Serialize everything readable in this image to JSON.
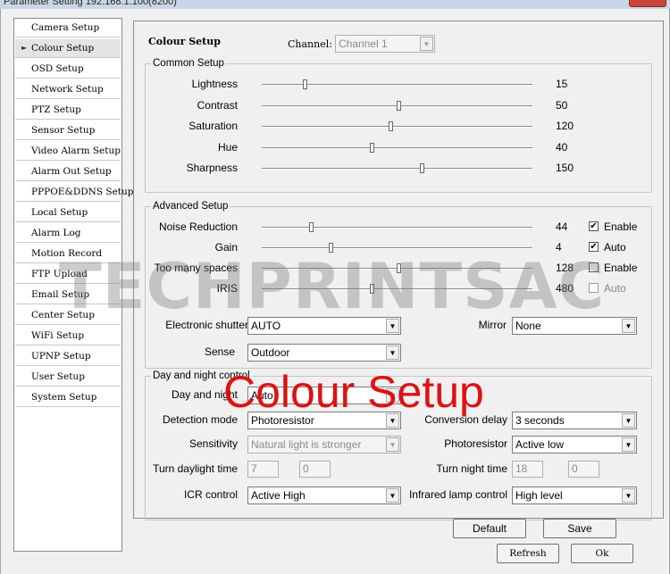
{
  "window_title": "Parameter Setting 192.168.1.100(8200)",
  "sidebar": {
    "items": [
      {
        "label": "Camera Setup",
        "active": false
      },
      {
        "label": "Colour Setup",
        "active": true
      },
      {
        "label": "OSD Setup",
        "active": false
      },
      {
        "label": "Network Setup",
        "active": false
      },
      {
        "label": "PTZ Setup",
        "active": false
      },
      {
        "label": "Sensor Setup",
        "active": false
      },
      {
        "label": "Video Alarm Setup",
        "active": false
      },
      {
        "label": "Alarm Out Setup",
        "active": false
      },
      {
        "label": "PPPOE&DDNS Setup",
        "active": false
      },
      {
        "label": "Local Setup",
        "active": false
      },
      {
        "label": "Alarm Log",
        "active": false
      },
      {
        "label": "Motion Record",
        "active": false
      },
      {
        "label": "FTP Upload",
        "active": false
      },
      {
        "label": "Email Setup",
        "active": false
      },
      {
        "label": "Center Setup",
        "active": false
      },
      {
        "label": "WiFi Setup",
        "active": false
      },
      {
        "label": "UPNP Setup",
        "active": false
      },
      {
        "label": "User Setup",
        "active": false
      },
      {
        "label": "System Setup",
        "active": false
      }
    ]
  },
  "header": {
    "title": "Colour Setup",
    "channel_label": "Channel:",
    "channel_value": "Channel 1"
  },
  "common": {
    "title": "Common Setup",
    "sliders": [
      {
        "label": "Lightness",
        "value": 15,
        "fraction": 0.16
      },
      {
        "label": "Contrast",
        "value": 50,
        "fraction": 0.505
      },
      {
        "label": "Saturation",
        "value": 120,
        "fraction": 0.475
      },
      {
        "label": "Hue",
        "value": 40,
        "fraction": 0.405
      },
      {
        "label": "Sharpness",
        "value": 150,
        "fraction": 0.59
      }
    ]
  },
  "advanced": {
    "title": "Advanced Setup",
    "sliders": [
      {
        "label": "Noise Reduction",
        "value": 44,
        "fraction": 0.18,
        "check_label": "Enable",
        "checked": true,
        "check_disabled": false
      },
      {
        "label": "Gain",
        "value": 4,
        "fraction": 0.255,
        "check_label": "Auto",
        "checked": true,
        "check_disabled": false
      },
      {
        "label": "Too many spaces",
        "value": 128,
        "fraction": 0.505,
        "check_label": "Enable",
        "checked": false,
        "check_disabled": false
      },
      {
        "label": "IRIS",
        "value": 480,
        "fraction": 0.405,
        "check_label": "Auto",
        "checked": false,
        "check_disabled": true
      }
    ],
    "electronic_shutter_label": "Electronic shutter",
    "electronic_shutter_value": "AUTO",
    "mirror_label": "Mirror",
    "mirror_value": "None",
    "sense_label": "Sense",
    "sense_value": "Outdoor"
  },
  "daynight": {
    "title": "Day and night control",
    "day_night_label": "Day and night",
    "day_night_value": "Auto",
    "detection_mode_label": "Detection mode",
    "detection_mode_value": "Photoresistor",
    "conversion_delay_label": "Conversion delay",
    "conversion_delay_value": "3 seconds",
    "sensitivity_label": "Sensitivity",
    "sensitivity_value": "Natural light is stronger",
    "photoresistor_label": "Photoresistor",
    "photoresistor_value": "Active low",
    "turn_daylight_label": "Turn daylight time",
    "turn_daylight_h": "7",
    "turn_daylight_m": "0",
    "turn_night_label": "Turn night time",
    "turn_night_h": "18",
    "turn_night_m": "0",
    "icr_label": "ICR control",
    "icr_value": "Active High",
    "infrared_label": "Infrared lamp control",
    "infrared_value": "High level"
  },
  "buttons": {
    "default": "Default",
    "save": "Save",
    "refresh": "Refresh",
    "ok": "Ok"
  },
  "watermark": "TECHPRINTSAC",
  "overlay_caption": "Colour Setup",
  "icons": {
    "dropdown": "chevron-down-icon",
    "active_item": "triangle-right-icon",
    "check": "checkmark-icon"
  }
}
